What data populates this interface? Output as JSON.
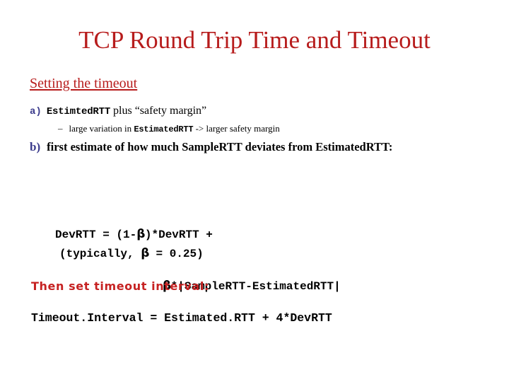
{
  "slide": {
    "title": "TCP Round Trip Time and Timeout",
    "section_heading": "Setting the timeout",
    "colors": {
      "title_red": "#B71C1C",
      "heading_red": "#B71C1C",
      "callout_red": "#C62222",
      "marker_blue": "#3B3B8C",
      "body_black": "#000000",
      "background": "#ffffff"
    }
  },
  "bullets": [
    {
      "marker": "a)",
      "code_term": "EstimtedRTT",
      "text_after": " plus “safety margin”"
    },
    {
      "marker": "b)",
      "text": "first estimate of how much SampleRTT deviates from EstimatedRTT:"
    }
  ],
  "sub_bullet": {
    "dash": "–",
    "text_before": "large variation in ",
    "code_term": "EstimatedRTT",
    "text_after": "  -> larger safety margin"
  },
  "formula": {
    "line1_before_beta": "DevRTT = (1-",
    "beta": "β",
    "line1_after_beta": ")*DevRTT +",
    "line2_beta": "β",
    "line2_after_beta": "*|SampleRTT-EstimatedRTT|"
  },
  "typically": {
    "before_beta": "(typically, ",
    "beta": "β",
    "after_beta": " = 0.25)"
  },
  "callout": {
    "text": "Then set timeout interval:"
  },
  "final_formula": {
    "text": "Timeout.Interval = Estimated.RTT + 4*DevRTT"
  }
}
